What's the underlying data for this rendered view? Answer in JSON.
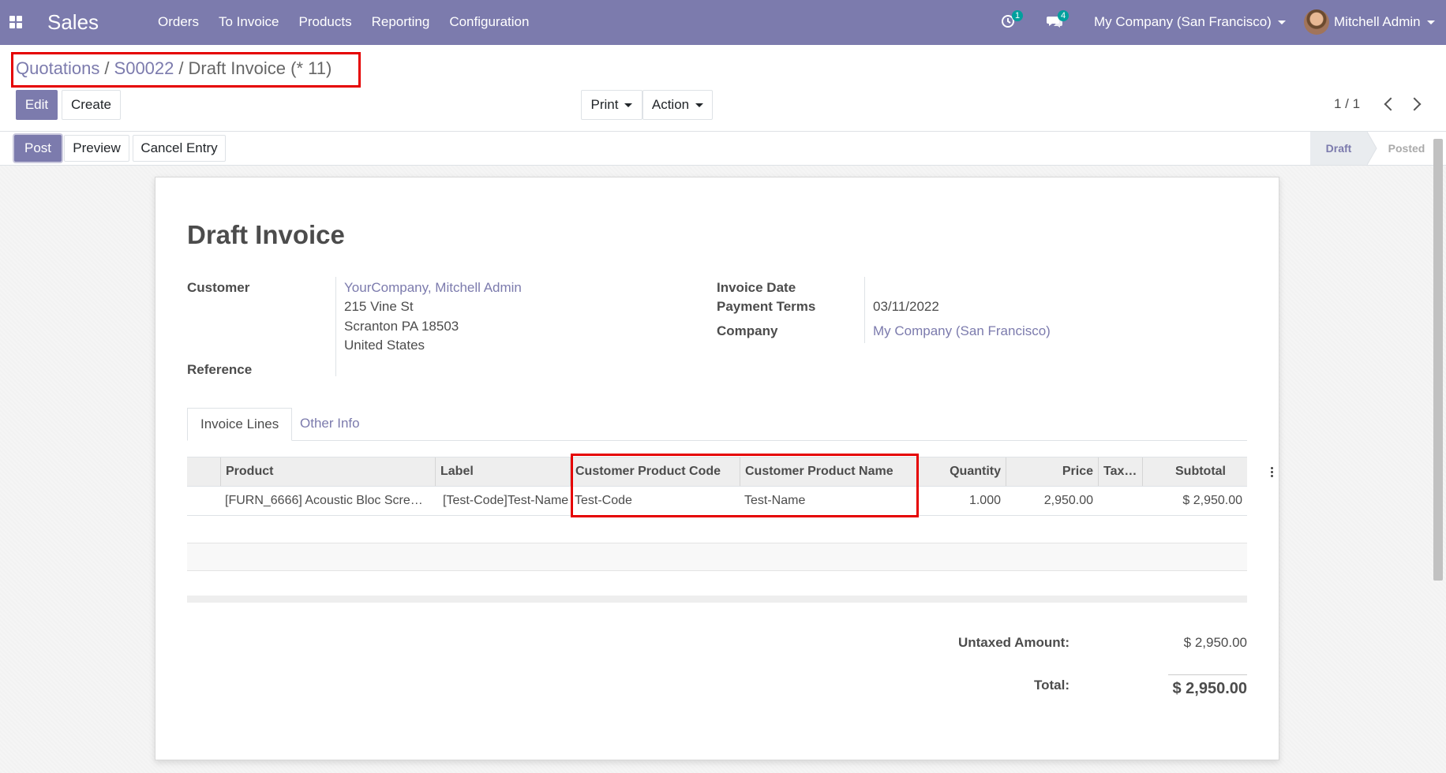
{
  "navbar": {
    "app_title": "Sales",
    "menu": [
      "Orders",
      "To Invoice",
      "Products",
      "Reporting",
      "Configuration"
    ],
    "activity_count": "1",
    "message_count": "4",
    "company": "My Company (San Francisco)",
    "user": "Mitchell Admin"
  },
  "breadcrumb": {
    "items": [
      "Quotations",
      "S00022"
    ],
    "current": "Draft Invoice (* 11)"
  },
  "controls": {
    "edit": "Edit",
    "create": "Create",
    "print": "Print",
    "action": "Action",
    "pager": "1 / 1"
  },
  "statusbar": {
    "post": "Post",
    "preview": "Preview",
    "cancel_entry": "Cancel Entry",
    "stages": [
      "Draft",
      "Posted"
    ]
  },
  "form": {
    "title": "Draft Invoice",
    "customer_label": "Customer",
    "customer_name": "YourCompany, Mitchell Admin",
    "address_line1": "215 Vine St",
    "address_line2": "Scranton PA 18503",
    "address_line3": "United States",
    "reference_label": "Reference",
    "invoice_date_label": "Invoice Date",
    "payment_terms_label": "Payment Terms",
    "payment_terms_value": "03/11/2022",
    "company_label": "Company",
    "company_value": "My Company (San Francisco)"
  },
  "tabs": [
    "Invoice Lines",
    "Other Info"
  ],
  "table": {
    "headers": [
      "Product",
      "Label",
      "Customer Product Code",
      "Customer Product Name",
      "Quantity",
      "Price",
      "Tax…",
      "Subtotal"
    ],
    "rows": [
      [
        "[FURN_6666] Acoustic Bloc Scre…",
        "[Test-Code]Test-Name",
        "Test-Code",
        "Test-Name",
        "1.000",
        "2,950.00",
        "",
        "$ 2,950.00"
      ]
    ]
  },
  "totals": {
    "untaxed_label": "Untaxed Amount:",
    "untaxed_value": "$ 2,950.00",
    "total_label": "Total:",
    "total_value": "$ 2,950.00"
  },
  "colors": {
    "brand": "#7c7bad",
    "highlight": "#e50000"
  }
}
